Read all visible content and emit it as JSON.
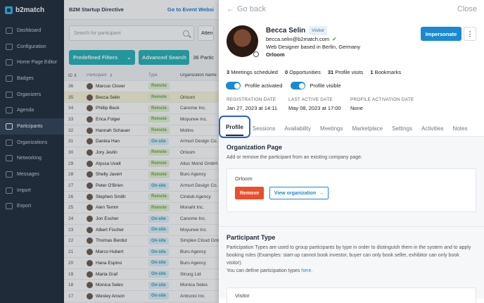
{
  "app": {
    "logo_text": "b2match"
  },
  "sidebar": {
    "items": [
      {
        "label": "Dashboard",
        "icon": "dashboard-icon"
      },
      {
        "label": "Configuration",
        "icon": "gear-icon"
      },
      {
        "label": "Home Page Editor",
        "icon": "page-editor-icon"
      },
      {
        "label": "Badges",
        "icon": "badge-icon"
      },
      {
        "label": "Organizers",
        "icon": "organizers-icon"
      },
      {
        "label": "Agenda",
        "icon": "agenda-icon"
      },
      {
        "label": "Participants",
        "icon": "participants-icon",
        "active": true
      },
      {
        "label": "Organizations",
        "icon": "organizations-icon"
      },
      {
        "label": "Networking",
        "icon": "networking-icon"
      },
      {
        "label": "Messages",
        "icon": "messages-icon"
      },
      {
        "label": "Import",
        "icon": "import-icon"
      },
      {
        "label": "Export",
        "icon": "export-icon"
      }
    ]
  },
  "header": {
    "title": "B2M Startup Directive",
    "event_link": "Go to Event Websi"
  },
  "search": {
    "placeholder": "Search for participant",
    "attendance": "Atten"
  },
  "filters": {
    "predefined_label": "Predefined Filters",
    "advanced_label": "Advanced Search",
    "count_text": "36 Partic"
  },
  "table": {
    "headers": {
      "id": "ID",
      "participant": "Participant",
      "type": "Type",
      "organization": "Organization Name"
    },
    "rows": [
      {
        "id": "36",
        "name": "Marcus Clover",
        "type": "Remote",
        "org": ""
      },
      {
        "id": "35",
        "name": "Becca Selin",
        "type": "Remote",
        "org": "Orloom"
      },
      {
        "id": "34",
        "name": "Phillip Beck",
        "type": "Remote",
        "org": "Canome Inc."
      },
      {
        "id": "33",
        "name": "Erica Folger",
        "type": "Remote",
        "org": "Moyurwe Inc."
      },
      {
        "id": "32",
        "name": "Hannah Schauer",
        "type": "Remote",
        "org": "Mollno"
      },
      {
        "id": "31",
        "name": "Danika Han",
        "type": "On-site",
        "org": "Armurt Design Co."
      },
      {
        "id": "30",
        "name": "Jory Jevlin",
        "type": "Remote",
        "org": "Orloom"
      },
      {
        "id": "29",
        "name": "Alyssa Uvalt",
        "type": "Remote",
        "org": "Altuc Mond GmbH"
      },
      {
        "id": "28",
        "name": "Shelly Javert",
        "type": "Remote",
        "org": "Buro Agency"
      },
      {
        "id": "27",
        "name": "Peter O'Brien",
        "type": "On-site",
        "org": "Armurt Design Co."
      },
      {
        "id": "26",
        "name": "Stephen Smith",
        "type": "Remote",
        "org": "Cindub Agency"
      },
      {
        "id": "25",
        "name": "Alen Temm",
        "type": "Remote",
        "org": "Monaht Inc."
      },
      {
        "id": "24",
        "name": "Jon Escher",
        "type": "On-site",
        "org": "Canome Inc."
      },
      {
        "id": "23",
        "name": "Albert Fischer",
        "type": "On-site",
        "org": "Moyurwe Inc."
      },
      {
        "id": "22",
        "name": "Thomas Berdut",
        "type": "On-site",
        "org": "Simplex Cloud GmbH"
      },
      {
        "id": "21",
        "name": "Marco Hubert",
        "type": "On-site",
        "org": "Buro Agency"
      },
      {
        "id": "20",
        "name": "Hana Espino",
        "type": "On-site",
        "org": "Buro Agency"
      },
      {
        "id": "19",
        "name": "Marta Graf",
        "type": "On-site",
        "org": "Strucg Ltd"
      },
      {
        "id": "18",
        "name": "Monica Seles",
        "type": "On-site",
        "org": "Monica Seles"
      },
      {
        "id": "17",
        "name": "Wesley Anson",
        "type": "On-site",
        "org": "Antrunci Inc."
      }
    ]
  },
  "panel": {
    "back_label": "Go back",
    "close_label": "Close",
    "name": "Becca Selin",
    "role_badge": "Visitor",
    "email": "becca.selin@b2match.com",
    "bio": "Web Designer based in Berlin, Germany",
    "organization": "Orloom",
    "impersonate_label": "Impersonate",
    "more_label": "⋮",
    "stats": [
      {
        "num": "3",
        "label": "Meetings scheduled"
      },
      {
        "num": "0",
        "label": "Opportunities"
      },
      {
        "num": "31",
        "label": "Profile visits"
      },
      {
        "num": "1",
        "label": "Bookmarks"
      }
    ],
    "toggles": {
      "activated": "Profile activated",
      "visible": "Profile visible"
    },
    "dates": [
      {
        "label": "REGISTRATION DATE",
        "value": "Jan 27, 2023 at 14:11"
      },
      {
        "label": "LAST ACTIVE DATE",
        "value": "May 08, 2023 at 17:00"
      },
      {
        "label": "PROFILE ACTIVATION DATE",
        "value": "None"
      }
    ],
    "tabs": [
      "Profile",
      "Sessions",
      "Availability",
      "Meetings",
      "Marketplace",
      "Settings",
      "Activities",
      "Notes"
    ],
    "org_page": {
      "title": "Organization Page",
      "desc": "Add or remove the participant from an existing company page.",
      "org_name": "Orloom",
      "remove_label": "Remove",
      "view_label": "View organization"
    },
    "ptype": {
      "title": "Participant Type",
      "desc": "Participation Types are used to group participants by type in order to distinguish them in the system and to apply booking rules (Examples: start-up cannot book investor, buyer can only book seller, exhibitor can only book visitor).",
      "define_text": "You can define participation types ",
      "link_text": "here",
      "value": "Visitor"
    }
  },
  "colors": {
    "sidebar": "#1e2a3a",
    "accent": "#1a8ad0",
    "teal": "#22b3b8",
    "remove": "#e8502c",
    "highlight": "#2b5fd9"
  }
}
